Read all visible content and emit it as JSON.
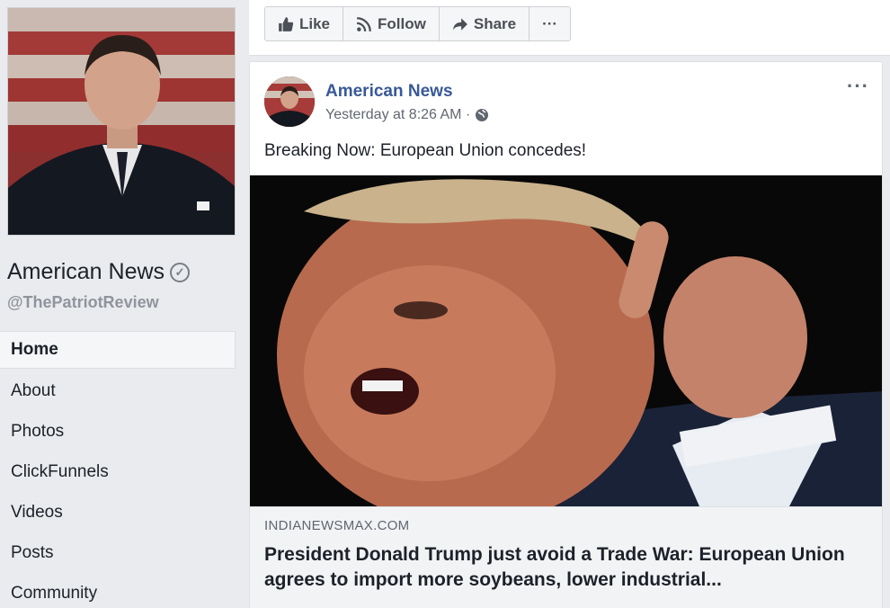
{
  "page": {
    "name": "American News",
    "handle": "@ThePatriotReview"
  },
  "nav": {
    "items": [
      {
        "label": "Home"
      },
      {
        "label": "About"
      },
      {
        "label": "Photos"
      },
      {
        "label": "ClickFunnels"
      },
      {
        "label": "Videos"
      },
      {
        "label": "Posts"
      },
      {
        "label": "Community"
      }
    ]
  },
  "actions": {
    "like": "Like",
    "follow": "Follow",
    "share": "Share",
    "more": "···"
  },
  "post": {
    "author": "American News",
    "timestamp": "Yesterday at 8:26 AM ·",
    "menu": "···",
    "text": "Breaking Now: European Union concedes!",
    "link": {
      "domain": "INDIANEWSMAX.COM",
      "title": "President Donald Trump just avoid a Trade War: European Union agrees to import more soybeans, lower industrial..."
    }
  },
  "colors": {
    "link_blue": "#385898",
    "background": "#e9ebee"
  }
}
